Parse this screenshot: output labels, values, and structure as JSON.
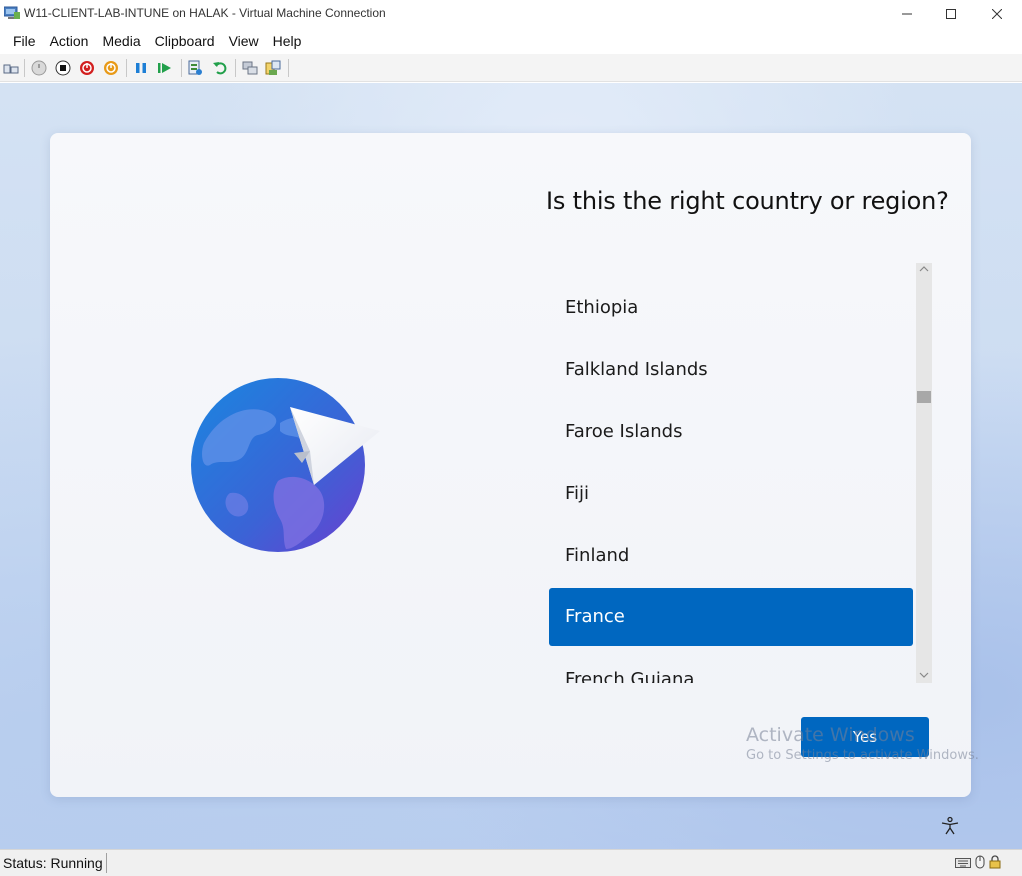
{
  "window": {
    "title": "W11-CLIENT-LAB-INTUNE on HALAK - Virtual Machine Connection",
    "minimize": "—",
    "maximize": "☐",
    "close": "✕"
  },
  "menu": [
    "File",
    "Action",
    "Media",
    "Clipboard",
    "View",
    "Help"
  ],
  "toolbar": {
    "icons": [
      "ctrl-alt-del-icon",
      "start-icon",
      "turn-off-icon",
      "shut-down-icon",
      "save-icon",
      "pause-icon",
      "reset-icon",
      "checkpoint-icon",
      "revert-icon",
      "enhanced-session-icon",
      "share-icon"
    ]
  },
  "setup": {
    "question": "Is this the right country or region?",
    "countries": [
      "Ethiopia",
      "Falkland Islands",
      "Faroe Islands",
      "Fiji",
      "Finland",
      "France",
      "French Guiana"
    ],
    "selected": "France",
    "yes_label": "Yes",
    "watermark_title": "Activate Windows",
    "watermark_sub": "Go to Settings to activate Windows."
  },
  "status": {
    "text": "Status: Running"
  },
  "colors": {
    "accent": "#0067c0",
    "card_bg": "#f2f4f9"
  }
}
